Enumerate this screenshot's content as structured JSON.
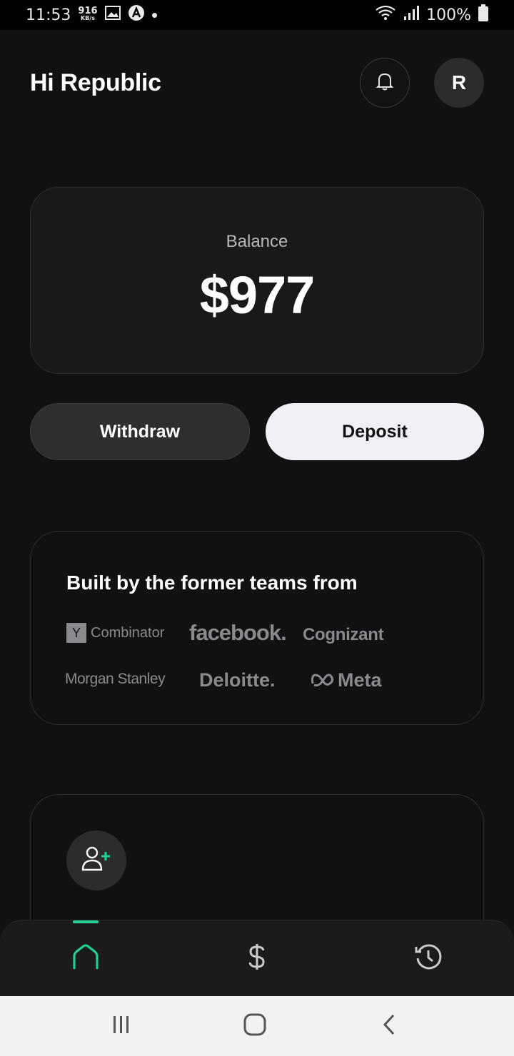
{
  "status_bar": {
    "time": "11:53",
    "net_speed_value": "916",
    "net_speed_unit": "KB/s",
    "battery": "100%",
    "icons": [
      "gallery-icon",
      "a-icon",
      "dot-icon",
      "wifi-icon",
      "signal-icon",
      "battery-icon"
    ]
  },
  "header": {
    "greeting": "Hi Republic",
    "avatar_initial": "R",
    "icons": [
      "bell-icon"
    ]
  },
  "balance": {
    "label": "Balance",
    "value": "$977"
  },
  "actions": {
    "withdraw_label": "Withdraw",
    "deposit_label": "Deposit"
  },
  "teams": {
    "title": "Built by the former teams from",
    "logos": {
      "yc_box": "Y",
      "yc_text": "Combinator",
      "facebook": "facebook.",
      "cognizant": "Cognizant",
      "morgan_stanley": "Morgan Stanley",
      "deloitte": "Deloitte.",
      "meta": "Meta"
    }
  },
  "invite": {
    "icons": [
      "add-user-icon"
    ]
  },
  "tabbar": {
    "tabs": [
      "home-tab",
      "dollar-tab",
      "history-tab"
    ],
    "active": "home-tab",
    "accent_color": "#1fd38e"
  },
  "navbar": {
    "icons": [
      "recents-icon",
      "home-icon",
      "back-icon"
    ]
  }
}
